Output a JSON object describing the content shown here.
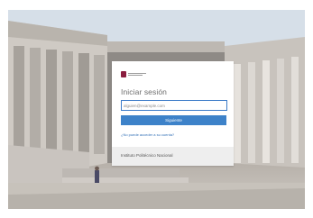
{
  "signin": {
    "title": "Iniciar sesión",
    "email_placeholder": "alguien@example.com",
    "email_value": "",
    "next_label": "Siguiente",
    "cant_access_label": "¿No puede acceder a su cuenta?",
    "org_name": "Instituto Politécnico Nacional"
  },
  "colors": {
    "accent": "#3d82c9",
    "brand": "#8b1e3f"
  },
  "icons": {
    "logo": "ipn-logo"
  }
}
